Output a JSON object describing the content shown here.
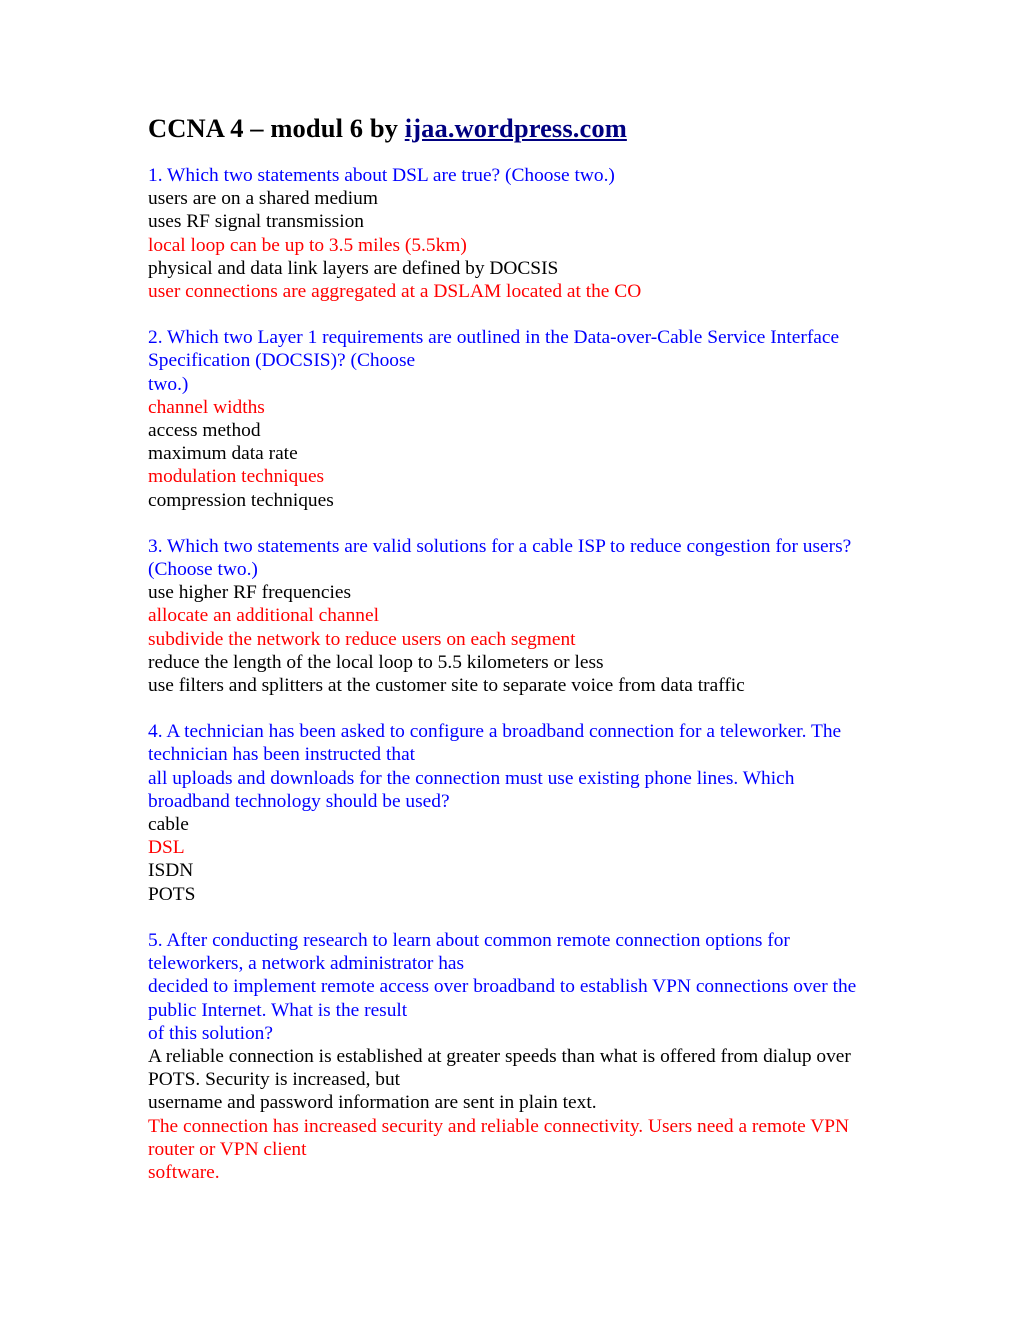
{
  "document": {
    "title_prefix": "CCNA 4 – modul 6 by ",
    "title_link": "ijaa.wordpress.com",
    "colors": {
      "question": "#0000ff",
      "correct_answer": "#ff0000",
      "option": "#000000",
      "link": "#000080",
      "background": "#ffffff"
    },
    "blocks": [
      {
        "id": "question-1",
        "lines": [
          {
            "kind": "question",
            "text": "1. Which two statements about DSL are true? (Choose two.)"
          },
          {
            "kind": "option",
            "text": "users are on a shared medium"
          },
          {
            "kind": "option",
            "text": "uses RF signal transmission"
          },
          {
            "kind": "correct",
            "text": "local loop can be up to 3.5 miles (5.5km)"
          },
          {
            "kind": "option",
            "text": "physical and data link layers are defined by DOCSIS"
          },
          {
            "kind": "correct",
            "text": "user connections are aggregated at a DSLAM located at the CO"
          }
        ]
      },
      {
        "id": "question-2",
        "lines": [
          {
            "kind": "question",
            "text": "2. Which two Layer 1 requirements are outlined in the Data-over-Cable Service Interface Specification (DOCSIS)? (Choose"
          },
          {
            "kind": "question",
            "text": "two.)"
          },
          {
            "kind": "correct",
            "text": "channel widths"
          },
          {
            "kind": "option",
            "text": "access method"
          },
          {
            "kind": "option",
            "text": "maximum data rate"
          },
          {
            "kind": "correct",
            "text": "modulation techniques"
          },
          {
            "kind": "option",
            "text": "compression techniques"
          }
        ]
      },
      {
        "id": "question-3",
        "lines": [
          {
            "kind": "question",
            "text": "3. Which two statements are valid solutions for a cable ISP to reduce congestion for users? (Choose two.)"
          },
          {
            "kind": "option",
            "text": "use higher RF frequencies"
          },
          {
            "kind": "correct",
            "text": "allocate an additional channel"
          },
          {
            "kind": "correct",
            "text": "subdivide the network to reduce users on each segment"
          },
          {
            "kind": "option",
            "text": "reduce the length of the local loop to 5.5 kilometers or less"
          },
          {
            "kind": "option",
            "text": "use filters and splitters at the customer site to separate voice from data traffic"
          }
        ]
      },
      {
        "id": "question-4",
        "lines": [
          {
            "kind": "question",
            "text": "4. A technician has been asked to configure a broadband connection for a teleworker. The technician has been instructed that"
          },
          {
            "kind": "question",
            "text": "all uploads and downloads for the connection must use existing phone lines. Which broadband technology should be used?"
          },
          {
            "kind": "option",
            "text": "cable"
          },
          {
            "kind": "correct",
            "text": "DSL"
          },
          {
            "kind": "option",
            "text": "ISDN"
          },
          {
            "kind": "option",
            "text": "POTS"
          }
        ]
      },
      {
        "id": "question-5",
        "lines": [
          {
            "kind": "question",
            "text": "5. After conducting research to learn about common remote connection options for teleworkers, a network administrator has"
          },
          {
            "kind": "question",
            "text": "decided to implement remote access over broadband to establish VPN connections over the public Internet. What is the result"
          },
          {
            "kind": "question",
            "text": "of this solution?"
          },
          {
            "kind": "option",
            "text": "A reliable connection is established at greater speeds than what is offered from dialup over POTS. Security is increased, but"
          },
          {
            "kind": "option",
            "text": "username and password information are sent in plain text."
          },
          {
            "kind": "correct",
            "text": "The connection has increased security and reliable connectivity. Users need a remote VPN router or VPN client"
          },
          {
            "kind": "correct",
            "text": "software."
          }
        ]
      }
    ]
  }
}
